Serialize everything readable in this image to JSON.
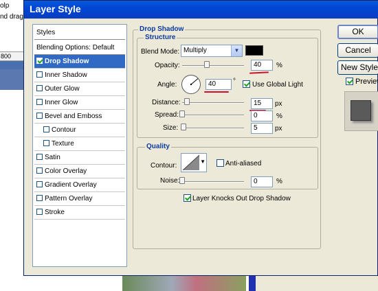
{
  "background": {
    "hint_line1": "olp",
    "hint_line2": "nd drag to",
    "ruler_mark": "800"
  },
  "dialog": {
    "title": "Layer Style",
    "buttons": {
      "ok": "OK",
      "cancel": "Cancel",
      "new_style": "New Style...",
      "preview": "Preview"
    },
    "preview_checked": true
  },
  "style_list": {
    "header": "Styles",
    "blending": "Blending Options: Default",
    "items": [
      {
        "label": "Drop Shadow",
        "checked": true,
        "selected": true,
        "sub": false
      },
      {
        "label": "Inner Shadow",
        "checked": false,
        "selected": false,
        "sub": false
      },
      {
        "label": "Outer Glow",
        "checked": false,
        "selected": false,
        "sub": false
      },
      {
        "label": "Inner Glow",
        "checked": false,
        "selected": false,
        "sub": false
      },
      {
        "label": "Bevel and Emboss",
        "checked": false,
        "selected": false,
        "sub": false
      },
      {
        "label": "Contour",
        "checked": false,
        "selected": false,
        "sub": true
      },
      {
        "label": "Texture",
        "checked": false,
        "selected": false,
        "sub": true
      },
      {
        "label": "Satin",
        "checked": false,
        "selected": false,
        "sub": false
      },
      {
        "label": "Color Overlay",
        "checked": false,
        "selected": false,
        "sub": false
      },
      {
        "label": "Gradient Overlay",
        "checked": false,
        "selected": false,
        "sub": false
      },
      {
        "label": "Pattern Overlay",
        "checked": false,
        "selected": false,
        "sub": false
      },
      {
        "label": "Stroke",
        "checked": false,
        "selected": false,
        "sub": false
      }
    ]
  },
  "drop_shadow": {
    "title": "Drop Shadow",
    "structure_title": "Structure",
    "blend_mode": {
      "label": "Blend Mode:",
      "value": "Multiply",
      "color": "#000000"
    },
    "opacity": {
      "label": "Opacity:",
      "value": "40",
      "unit": "%",
      "level": 0.4
    },
    "angle": {
      "label": "Angle:",
      "value": "40",
      "unit": "°",
      "use_global_light": "Use Global Light",
      "global_checked": true
    },
    "distance": {
      "label": "Distance:",
      "value": "15",
      "unit": "px",
      "level": 0.08
    },
    "spread": {
      "label": "Spread:",
      "value": "0",
      "unit": "%",
      "level": 0
    },
    "size": {
      "label": "Size:",
      "value": "5",
      "unit": "px",
      "level": 0.02
    },
    "quality_title": "Quality",
    "contour": {
      "label": "Contour:",
      "anti_aliased": "Anti-aliased",
      "anti_checked": false
    },
    "noise": {
      "label": "Noise:",
      "value": "0",
      "unit": "%",
      "level": 0
    },
    "knockout": {
      "label": "Layer Knocks Out Drop Shadow",
      "checked": true
    }
  },
  "colors": {
    "title_bar": "#0046d5",
    "selection": "#316ac5",
    "annotation_red": "#d0102a"
  }
}
